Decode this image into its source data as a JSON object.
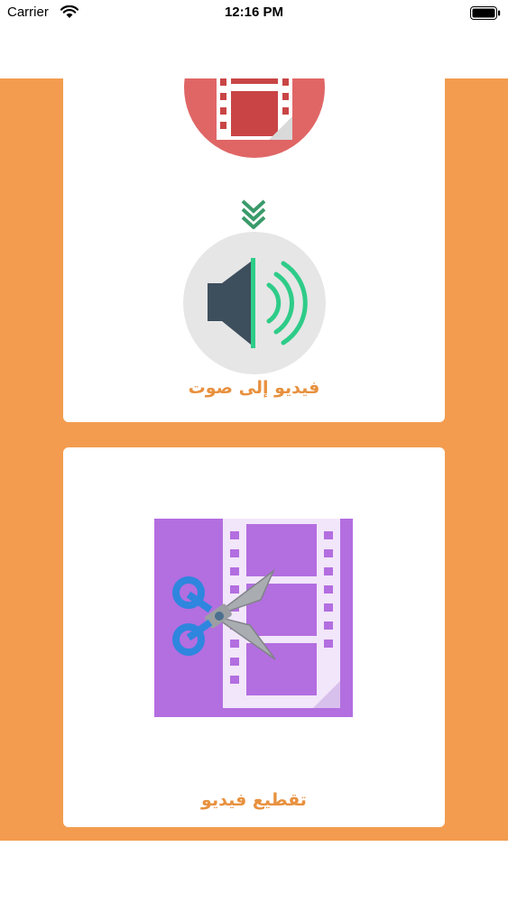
{
  "status_bar": {
    "carrier": "Carrier",
    "time": "12:16 PM"
  },
  "cards": [
    {
      "label": "فيديو إلى صوت",
      "icons": [
        "film-circle-icon",
        "double-chevron-down-icon",
        "speaker-circle-icon"
      ]
    },
    {
      "label": "تقطيع فيديو",
      "icons": [
        "video-cut-icon"
      ]
    }
  ],
  "colors": {
    "background": "#f39c4f",
    "label": "#e8913f",
    "film_circle": "#e06666",
    "video_cut_tile": "#b36ee0",
    "speaker_circle": "#e6e6e6",
    "sound_waves": "#2ecc88",
    "arrow": "#3a9a6a"
  }
}
